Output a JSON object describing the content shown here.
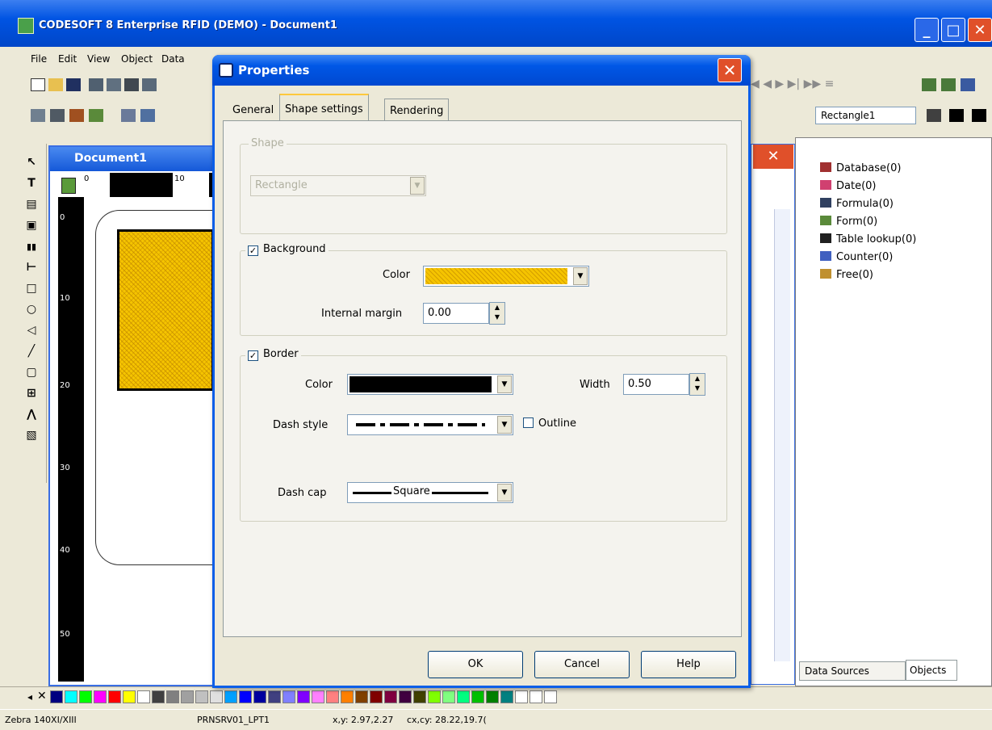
{
  "app": {
    "title": "CODESOFT 8 Enterprise RFID (DEMO) - Document1",
    "menus": [
      "File",
      "Edit",
      "View",
      "Object",
      "Data"
    ],
    "object_selector": "Rectangle1"
  },
  "document": {
    "title": "Document1",
    "ruler_top": [
      "0",
      "10"
    ],
    "ruler_left": [
      "0",
      "10",
      "20",
      "30",
      "40",
      "50"
    ]
  },
  "right_panel": {
    "items": [
      {
        "label": "Database(0)",
        "icon": "database-icon"
      },
      {
        "label": "Date(0)",
        "icon": "calendar-icon"
      },
      {
        "label": "Formula(0)",
        "icon": "formula-icon"
      },
      {
        "label": "Form(0)",
        "icon": "form-icon"
      },
      {
        "label": "Table lookup(0)",
        "icon": "table-lookup-icon"
      },
      {
        "label": "Counter(0)",
        "icon": "counter-icon"
      },
      {
        "label": "Free(0)",
        "icon": "free-icon"
      }
    ],
    "tabs": [
      "Data Sources",
      "Objects"
    ]
  },
  "status": {
    "printer": "Zebra 140XI/XIII",
    "port": "PRNSRV01_LPT1",
    "xy": "x,y: 2.97,2.27",
    "cxcy": "cx,cy: 28.22,19.7("
  },
  "dialog": {
    "title": "Properties",
    "tabs": [
      "General",
      "Shape settings",
      "Rendering"
    ],
    "active_tab": "Shape settings",
    "shape": {
      "group_label": "Shape",
      "value": "Rectangle"
    },
    "background": {
      "group_label": "Background",
      "checked": true,
      "color_label": "Color",
      "color": "#f5c400",
      "margin_label": "Internal margin",
      "margin_value": "0.00"
    },
    "border": {
      "group_label": "Border",
      "checked": true,
      "color_label": "Color",
      "color": "#000000",
      "width_label": "Width",
      "width_value": "0.50",
      "dash_style_label": "Dash style",
      "outline_label": "Outline",
      "outline_checked": false,
      "dash_cap_label": "Dash cap",
      "dash_cap_value": "Square"
    },
    "buttons": {
      "ok": "OK",
      "cancel": "Cancel",
      "help": "Help"
    }
  },
  "palette": [
    "#000080",
    "#00ffff",
    "#00ff00",
    "#ff00ff",
    "#ff0000",
    "#ffff00",
    "#ffffff",
    "#404040",
    "#808080",
    "#a0a0a0",
    "#c0c0c0",
    "#e0e0e0",
    "#00a0ff",
    "#0000ff",
    "#0000a0",
    "#404080",
    "#8080ff",
    "#8000ff",
    "#ff80ff",
    "#ff8080",
    "#ff8000",
    "#804000",
    "#800000",
    "#800040",
    "#400040",
    "#404000",
    "#80ff00",
    "#80ff80",
    "#00ff80",
    "#00c000",
    "#008000",
    "#008080",
    "#ffffff",
    "#ffffff",
    "#ffffff"
  ]
}
